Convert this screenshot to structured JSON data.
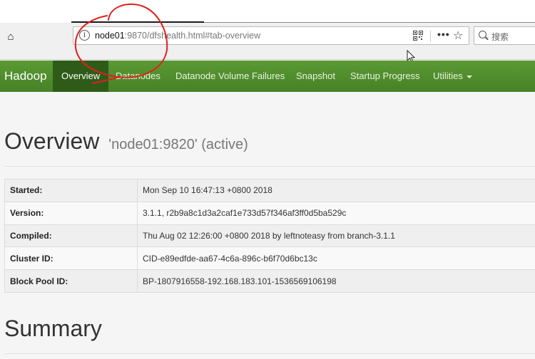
{
  "browser": {
    "url_host": "node01",
    "url_rest": ":9870/dfshealth.html#tab-overview",
    "search_placeholder": "搜索",
    "icons": {
      "home": "home-icon",
      "info": "info-icon",
      "qr": "qr-code-icon",
      "more": "more-icon",
      "bookmark": "star-icon",
      "search": "search-icon",
      "cursor": "mouse-cursor-icon"
    }
  },
  "navbar": {
    "brand": "Hadoop",
    "items": [
      {
        "label": "Overview",
        "active": true
      },
      {
        "label": "Datanodes"
      },
      {
        "label": "Datanode Volume Failures"
      },
      {
        "label": "Snapshot"
      },
      {
        "label": "Startup Progress"
      },
      {
        "label": "Utilities"
      }
    ],
    "accent": "#4e8a2c",
    "active_bg": "#2f5b18"
  },
  "overview": {
    "title": "Overview",
    "subtitle": "'node01:9820' (active)",
    "rows": [
      {
        "key": "Started:",
        "value": "Mon Sep 10 16:47:13 +0800 2018"
      },
      {
        "key": "Version:",
        "value": "3.1.1, r2b9a8c1d3a2caf1e733d57f346af3ff0d5ba529c"
      },
      {
        "key": "Compiled:",
        "value": "Thu Aug 02 12:26:00 +0800 2018 by leftnoteasy from branch-3.1.1"
      },
      {
        "key": "Cluster ID:",
        "value": "CID-e89edfde-aa67-4c6a-896c-b6f70d6bc13c"
      },
      {
        "key": "Block Pool ID:",
        "value": "BP-1807916558-192.168.183.101-1536569106198"
      }
    ]
  },
  "summary": {
    "title": "Summary"
  },
  "annotation": {
    "color": "#e0201c"
  }
}
